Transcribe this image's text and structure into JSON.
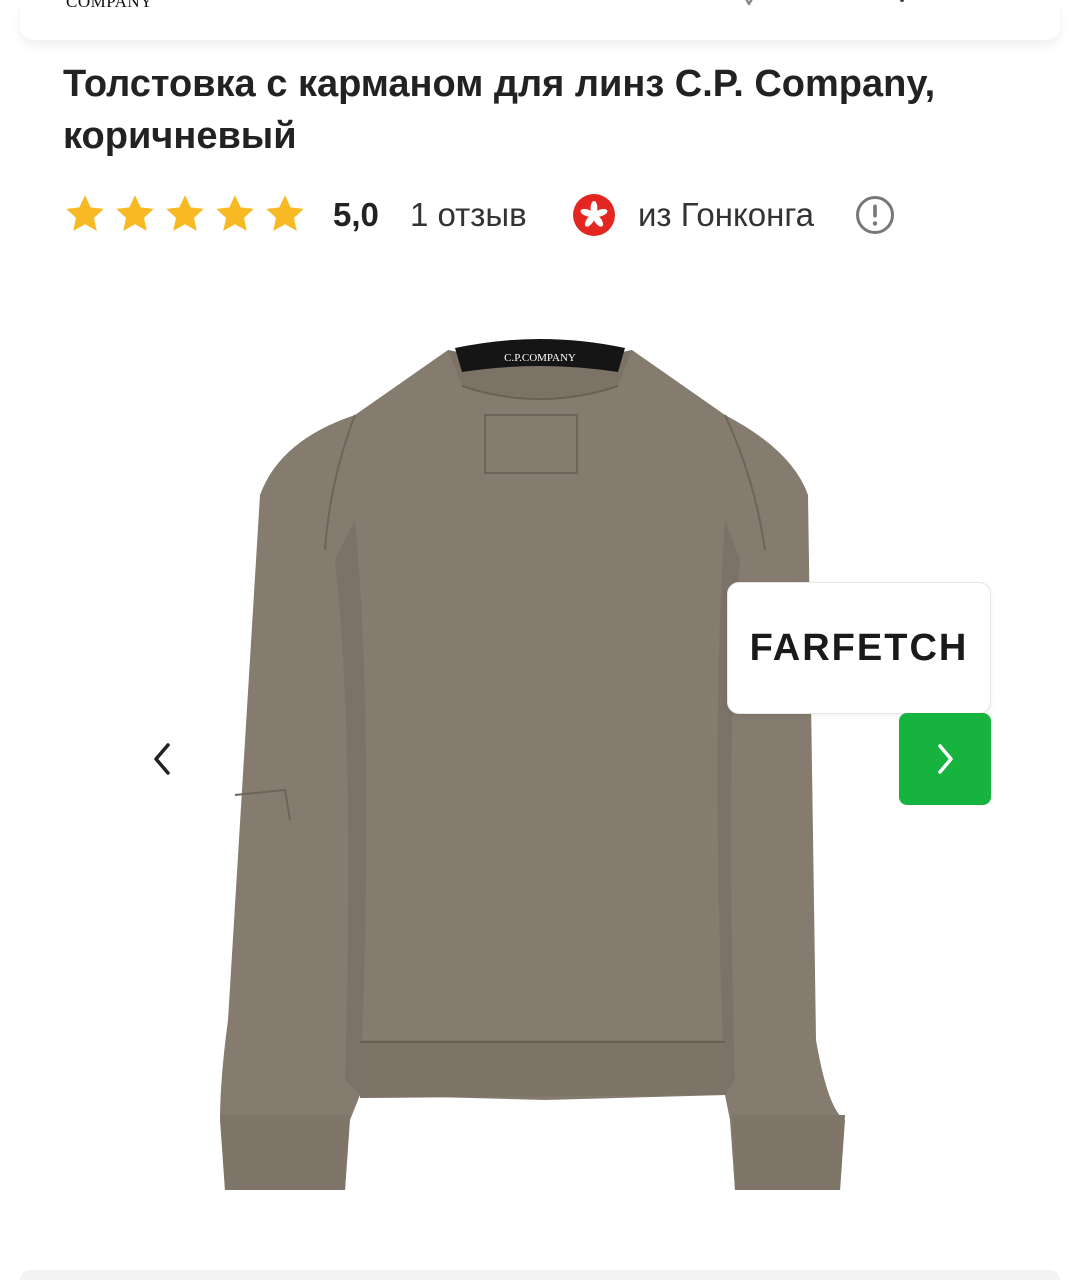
{
  "header": {
    "brand_logo": "COMPANY"
  },
  "product": {
    "title": "Толстовка с карманом для линз C.P. Company, коричневый",
    "rating_value": "5,0",
    "reviews_label": "1 отзыв",
    "stars_filled": 5,
    "origin_label": "из Гонконга",
    "image_print": "C.P.COMPANY",
    "seller_logo": "FARFETCH"
  },
  "icons": {
    "star": "star-icon",
    "flag": "hong-kong-flag-icon",
    "info": "info-icon",
    "prev": "chevron-left-icon",
    "next": "chevron-right-icon"
  },
  "colors": {
    "accent_green": "#16b33f",
    "star_yellow": "#f7b924",
    "flag_red": "#e3261f",
    "garment": "#857b6f"
  }
}
